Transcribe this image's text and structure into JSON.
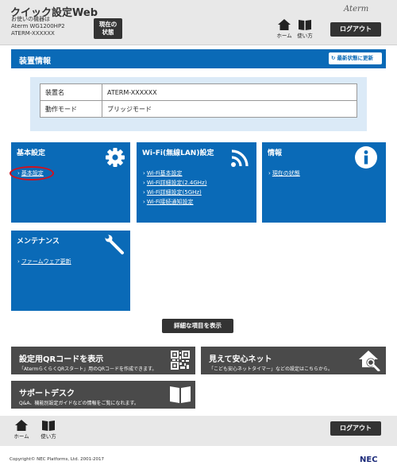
{
  "header": {
    "title": "クイック設定Web",
    "device_lines": [
      "お使いの機器は",
      "Aterm WG1200HP2",
      "ATERM-XXXXXX"
    ],
    "status_button": [
      "現在の",
      "状態"
    ],
    "brand": "Aterm",
    "home_label": "ホーム",
    "help_label": "使い方",
    "logout_label": "ログアウト"
  },
  "section": {
    "title": "装置情報",
    "refresh_label": "最新状態に更新"
  },
  "device_info": [
    {
      "key": "装置名",
      "value": "ATERM-XXXXXX"
    },
    {
      "key": "動作モード",
      "value": "ブリッジモード"
    }
  ],
  "tiles": {
    "basic": {
      "title": "基本設定",
      "icon": "gear-icon",
      "links": [
        "基本設定"
      ]
    },
    "wifi": {
      "title": "Wi-Fi(無線LAN)設定",
      "icon": "wifi-icon",
      "links": [
        "Wi-Fi基本設定",
        "Wi-Fi詳細設定(2.4GHz)",
        "Wi-Fi詳細設定(5GHz)",
        "Wi-Fi接続通知設定"
      ]
    },
    "info": {
      "title": "情報",
      "icon": "info-icon",
      "links": [
        "現在の状態"
      ]
    },
    "maintenance": {
      "title": "メンテナンス",
      "icon": "wrench-icon",
      "links": [
        "ファームウェア更新"
      ]
    }
  },
  "detail_button": "詳細な項目を表示",
  "services": {
    "qr": {
      "title": "設定用QRコードを表示",
      "desc": "「AtermらくらくQRスタート」用のQRコードを作成できます。",
      "icon": "qr-code-icon"
    },
    "safety": {
      "title": "見えて安心ネット",
      "desc": "「こども安心ネットタイマー」などの設定はこちらから。",
      "icon": "house-search-icon"
    },
    "support": {
      "title": "サポートデスク",
      "desc": "Q&A、機能別設定ガイドなどの情報をご覧になれます。",
      "icon": "book-icon"
    }
  },
  "footer": {
    "home_label": "ホーム",
    "help_label": "使い方",
    "logout_label": "ログアウト",
    "copyright": "Copyright© NEC Platforms, Ltd. 2001-2017",
    "logo": "NEC"
  },
  "colors": {
    "primary_blue": "#0a6ab7",
    "dark_button": "#333333",
    "service_gray": "#4a4a4a",
    "highlight_red": "#d0121f"
  }
}
